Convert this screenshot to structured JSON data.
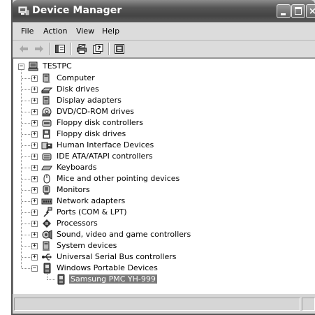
{
  "window": {
    "title": "Device Manager"
  },
  "menu": {
    "file": "File",
    "action": "Action",
    "view": "View",
    "help": "Help"
  },
  "toolbar": {
    "buttons": [
      "back-arrow-icon",
      "forward-arrow-icon",
      "show-hide-console-tree-icon",
      "print-icon",
      "help-icon",
      "properties-icon"
    ]
  },
  "tree": {
    "root": "TESTPC",
    "categories": [
      "Computer",
      "Disk drives",
      "Display adapters",
      "DVD/CD-ROM drives",
      "Floppy disk controllers",
      "Floppy disk drives",
      "Human Interface Devices",
      "IDE ATA/ATAPI controllers",
      "Keyboards",
      "Mice and other pointing devices",
      "Monitors",
      "Network adapters",
      "Ports (COM & LPT)",
      "Processors",
      "Sound, video and game controllers",
      "System devices",
      "Universal Serial Bus controllers",
      "Windows Portable Devices"
    ],
    "expanded_category_child": "Samsung PMC YH-999"
  },
  "colors": {
    "titlebar": "#4a4a4a",
    "selection": "#7a7a7a",
    "chrome": "#d6d6d6"
  }
}
